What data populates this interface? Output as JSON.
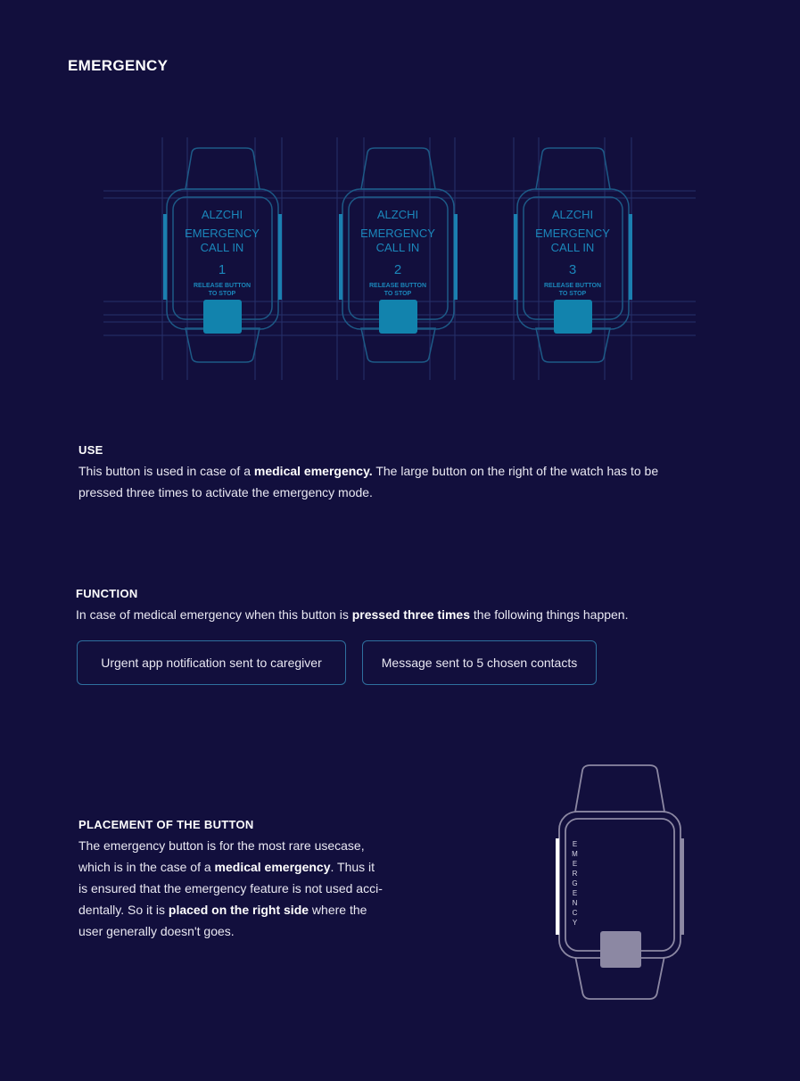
{
  "page": {
    "title": "EMERGENCY"
  },
  "watch_screens": [
    {
      "app": "ALZCHI",
      "line1": "EMERGENCY",
      "line2": "CALL IN",
      "count": "1",
      "hint1": "RELEASE BUTTON",
      "hint2": "TO STOP"
    },
    {
      "app": "ALZCHI",
      "line1": "EMERGENCY",
      "line2": "CALL IN",
      "count": "2",
      "hint1": "RELEASE BUTTON",
      "hint2": "TO STOP"
    },
    {
      "app": "ALZCHI",
      "line1": "EMERGENCY",
      "line2": "CALL IN",
      "count": "3",
      "hint1": "RELEASE BUTTON",
      "hint2": "TO STOP"
    }
  ],
  "use": {
    "heading": "USE",
    "t1": "This button is used in case of a ",
    "b1": "medical emergency.",
    "t2": " The large button on the right of the watch has to be",
    "t3": "pressed three times to activate the emergency mode."
  },
  "function": {
    "heading": "FUNCTION",
    "t1": "In case of medical emergency when this button is ",
    "b1": "pressed three times",
    "t2": " the following things happen.",
    "items": [
      "Urgent app notification sent to caregiver",
      "Message sent to 5 chosen contacts"
    ]
  },
  "placement": {
    "heading": "PLACEMENT OF THE BUTTON",
    "l1": "The emergency button is for the most rare usecase,",
    "l2a": "which is in the case of a ",
    "l2b": "medical emergency",
    "l2c": ". Thus it",
    "l3": "is ensured that the emergency feature is not used acci-",
    "l4a": "dentally. So it is ",
    "l4b": "placed on the right side",
    "l4c": " where the",
    "l5": "user generally doesn't goes."
  },
  "side_label": [
    "E",
    "M",
    "E",
    "R",
    "G",
    "E",
    "N",
    "C",
    "Y"
  ],
  "colors": {
    "background": "#120f3d",
    "accent": "#1b7fb0",
    "outline": "#1d5a87",
    "button": "#1283ad",
    "grey_button": "#8c88a3"
  }
}
